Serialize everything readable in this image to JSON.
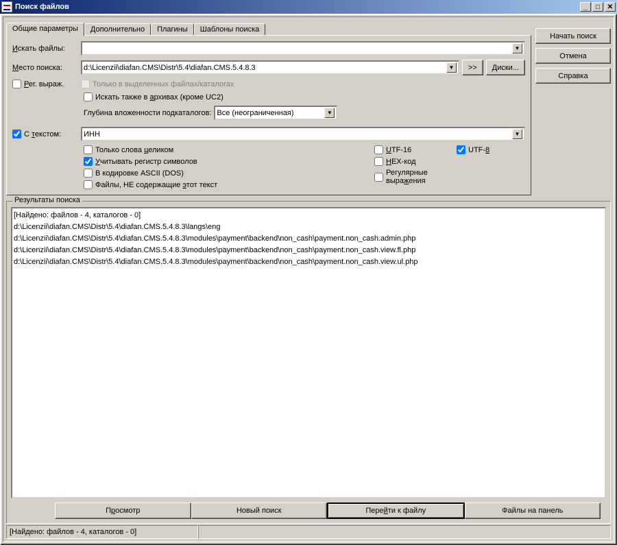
{
  "window": {
    "title": "Поиск файлов"
  },
  "tabs": {
    "general": "Общие параметры",
    "advanced": "Дополнительно",
    "plugins": "Плагины",
    "templates": "Шаблоны поиска"
  },
  "buttons": {
    "start_search": "Начать поиск",
    "cancel": "Отмена",
    "help": "Справка",
    "more_path": ">>",
    "drives": "Диски...",
    "view": "Просмотр",
    "new_search": "Новый поиск",
    "goto_file": "Перейти к файлу",
    "to_panel": "Файлы на панель"
  },
  "labels": {
    "search_files": "Искать файлы:",
    "search_in": "Место поиска:",
    "regex": "Рег. выраж.",
    "only_selected": "Только в выделенных файлах/каталогах",
    "archives": "Искать также в архивах (кроме UC2)",
    "depth": "Глубина вложенности подкаталогов:",
    "with_text": "С текстом:",
    "whole_words": "Только слова целиком",
    "case": "Учитывать регистр символов",
    "ascii": "В кодировке ASCII (DOS)",
    "not_containing": "Файлы, НЕ содержащие этот текст",
    "utf16": "UTF-16",
    "hex": "HEX-код",
    "regexp_text": "Регулярные выражения",
    "utf8": "UTF-8",
    "results": "Результаты поиска"
  },
  "values": {
    "mask": "",
    "path": "d:\\Licenzii\\diafan.CMS\\Distr\\5.4\\diafan.CMS.5.4.8.3",
    "depth_value": "Все (неограниченная)",
    "text": "ИНН"
  },
  "checks": {
    "regex": false,
    "only_selected": false,
    "archives": false,
    "with_text": true,
    "whole_words": false,
    "case": true,
    "ascii": false,
    "not_containing": false,
    "utf16": false,
    "hex": false,
    "regexp_text": false,
    "utf8": true
  },
  "results": {
    "summary": "[Найдено: файлов - 4, каталогов - 0]",
    "items": [
      "d:\\Licenzii\\diafan.CMS\\Distr\\5.4\\diafan.CMS.5.4.8.3\\langs\\eng",
      "d:\\Licenzii\\diafan.CMS\\Distr\\5.4\\diafan.CMS.5.4.8.3\\modules\\payment\\backend\\non_cash\\payment.non_cash.admin.php",
      "d:\\Licenzii\\diafan.CMS\\Distr\\5.4\\diafan.CMS.5.4.8.3\\modules\\payment\\backend\\non_cash\\payment.non_cash.view.fl.php",
      "d:\\Licenzii\\diafan.CMS\\Distr\\5.4\\diafan.CMS.5.4.8.3\\modules\\payment\\backend\\non_cash\\payment.non_cash.view.ul.php"
    ]
  },
  "status": {
    "text": "[Найдено: файлов - 4, каталогов - 0]"
  }
}
